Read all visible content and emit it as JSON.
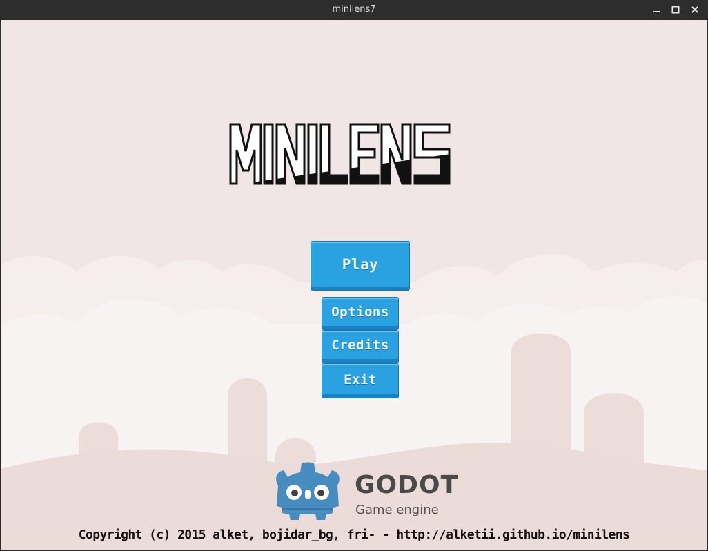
{
  "window": {
    "title": "minilens7",
    "controls": {
      "minimize_icon": "minimize-icon",
      "maximize_icon": "maximize-icon",
      "close_icon": "close-icon"
    }
  },
  "game": {
    "logo_title": "MINILENS",
    "menu": {
      "play": "Play",
      "options": "Options",
      "credits": "Credits",
      "exit": "Exit"
    },
    "engine_logo": {
      "name": "GODOT",
      "subtitle": "Game engine"
    },
    "copyright": "Copyright (c) 2015 alket, bojidar_bg, fri- - http://alketii.github.io/minilens"
  },
  "colors": {
    "background": "#f0e6e6",
    "button": "#2aa2e2",
    "button_border": "#1577b3",
    "godot_blue": "#478cbf",
    "titlebar": "#2d2d2d"
  }
}
